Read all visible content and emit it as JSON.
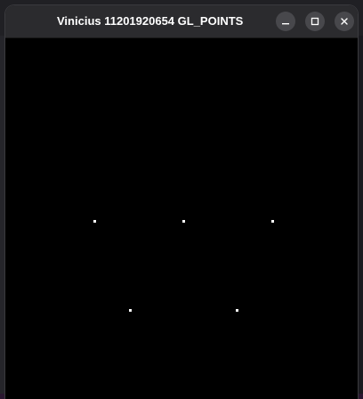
{
  "window": {
    "title": "Vinicius 11201920654 GL_POINTS",
    "controls": {
      "minimize": "minimize-icon",
      "maximize": "maximize-icon",
      "close": "close-icon"
    }
  },
  "canvas": {
    "background": "#000000",
    "point_color": "#ffffff",
    "point_count": 5
  }
}
